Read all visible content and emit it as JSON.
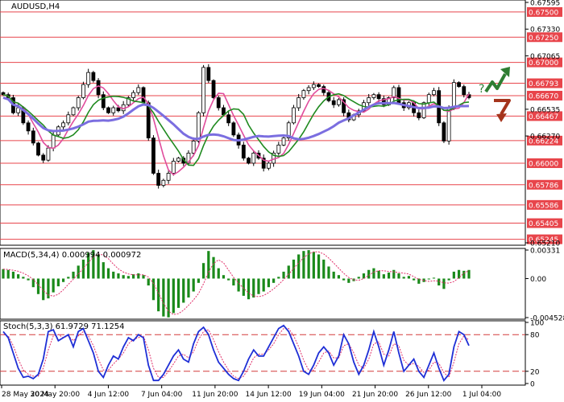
{
  "chart_data": {
    "type": "candlestick",
    "symbol": "AUDUSD,H4",
    "price_axis": {
      "ylim": [
        0.6521,
        0.67595
      ],
      "tick_labels": [
        "0.67595",
        "0.67330",
        "0.67065",
        "0.66535",
        "0.66270",
        "0.65210"
      ]
    },
    "levels": [
      {
        "value": "0.67500",
        "color": "#e8454b"
      },
      {
        "value": "0.67250",
        "color": "#e8454b"
      },
      {
        "value": "0.67000",
        "color": "#e8454b"
      },
      {
        "value": "0.66793",
        "color": "#e8454b"
      },
      {
        "value": "0.66670",
        "color": "#e8454b"
      },
      {
        "value": "0.66467",
        "color": "#e8454b"
      },
      {
        "value": "0.66224",
        "color": "#e8454b"
      },
      {
        "value": "0.66000",
        "color": "#e8454b"
      },
      {
        "value": "0.65786",
        "color": "#e8454b"
      },
      {
        "value": "0.65586",
        "color": "#e8454b"
      },
      {
        "value": "0.65405",
        "color": "#e8454b"
      },
      {
        "value": "0.65245",
        "color": "#e8454b"
      }
    ],
    "close_prices": [
      0.6668,
      0.6665,
      0.665,
      0.6655,
      0.664,
      0.6632,
      0.662,
      0.6608,
      0.6603,
      0.6615,
      0.6628,
      0.6636,
      0.664,
      0.6648,
      0.6655,
      0.6665,
      0.6678,
      0.669,
      0.6682,
      0.6668,
      0.6655,
      0.665,
      0.6655,
      0.6652,
      0.6658,
      0.6665,
      0.667,
      0.6675,
      0.666,
      0.6625,
      0.659,
      0.6578,
      0.6583,
      0.659,
      0.6602,
      0.6605,
      0.66,
      0.661,
      0.6622,
      0.665,
      0.6695,
      0.6682,
      0.6665,
      0.6655,
      0.6648,
      0.664,
      0.6628,
      0.6618,
      0.6605,
      0.66,
      0.661,
      0.6605,
      0.6595,
      0.66,
      0.661,
      0.6618,
      0.6625,
      0.664,
      0.6655,
      0.6665,
      0.6672,
      0.6675,
      0.6678,
      0.6676,
      0.667,
      0.6662,
      0.6658,
      0.6663,
      0.665,
      0.6643,
      0.6648,
      0.6652,
      0.666,
      0.6665,
      0.6668,
      0.6664,
      0.6658,
      0.6665,
      0.6675,
      0.666,
      0.6655,
      0.666,
      0.665,
      0.6645,
      0.666,
      0.6668,
      0.6672,
      0.664,
      0.6622,
      0.6655,
      0.668,
      0.6676,
      0.6668,
      0.6665
    ],
    "moving_averages": [
      {
        "color": "#e04c9c",
        "period_hint": "fast"
      },
      {
        "color": "#1f8a1f",
        "period_hint": "medium"
      },
      {
        "color": "#7b6ee0",
        "period_hint": "slow"
      }
    ],
    "arrows": [
      {
        "direction": "up",
        "color": "#2e7d32"
      },
      {
        "direction": "down",
        "color": "#a5341c"
      }
    ],
    "question_mark": "?",
    "macd": {
      "label": "MACD(5,34,4) 0.000994 0.000972",
      "tick_labels": [
        "0.00331",
        "0.00",
        "-0.004528"
      ],
      "ylim": [
        -0.004528,
        0.00331
      ],
      "values": [
        0.0011,
        0.001,
        0.0008,
        0.0005,
        0.0002,
        -0.0002,
        -0.001,
        -0.0018,
        -0.0025,
        -0.0023,
        -0.0016,
        -0.0009,
        -0.0004,
        0.0002,
        0.0008,
        0.0015,
        0.0022,
        0.003,
        0.0033,
        0.0028,
        0.0019,
        0.0012,
        0.0008,
        0.0006,
        0.0004,
        0.0003,
        0.0005,
        0.0006,
        0.0004,
        -0.0008,
        -0.0025,
        -0.0038,
        -0.0044,
        -0.0045,
        -0.004,
        -0.0034,
        -0.0028,
        -0.0022,
        -0.0015,
        -0.0005,
        0.0018,
        0.0032,
        0.0025,
        0.0012,
        0.0004,
        -0.0002,
        -0.0008,
        -0.0015,
        -0.002,
        -0.0024,
        -0.0022,
        -0.0018,
        -0.0015,
        -0.001,
        -0.0005,
        0.0002,
        0.0008,
        0.0015,
        0.0022,
        0.0028,
        0.0032,
        0.0033,
        0.0031,
        0.0028,
        0.0022,
        0.0014,
        0.0008,
        0.0004,
        -0.0002,
        -0.0005,
        -0.0003,
        0.0002,
        0.0006,
        0.001,
        0.0012,
        0.0009,
        0.0005,
        0.0007,
        0.001,
        0.0006,
        0.0002,
        0.0003,
        -0.0002,
        -0.0006,
        -0.0004,
        -0.0001,
        0.0001,
        -0.0008,
        -0.0012,
        -0.0002,
        0.0008,
        0.001,
        0.0009,
        0.001
      ]
    },
    "stochastic": {
      "label": "Stoch(5,3,3) 61.9729 71.1254",
      "tick_labels": [
        "100",
        "80",
        "20",
        "0"
      ],
      "levels": [
        80,
        20
      ],
      "ylim": [
        0,
        100
      ],
      "k_values": [
        85,
        75,
        50,
        25,
        10,
        12,
        8,
        15,
        40,
        85,
        88,
        70,
        75,
        80,
        60,
        85,
        90,
        70,
        50,
        20,
        10,
        30,
        45,
        40,
        60,
        75,
        70,
        80,
        75,
        30,
        5,
        5,
        15,
        30,
        45,
        55,
        40,
        35,
        65,
        85,
        92,
        80,
        55,
        35,
        25,
        15,
        8,
        5,
        20,
        40,
        55,
        45,
        45,
        60,
        75,
        90,
        95,
        85,
        65,
        45,
        20,
        15,
        30,
        50,
        60,
        50,
        30,
        45,
        80,
        65,
        35,
        15,
        30,
        55,
        85,
        60,
        30,
        55,
        85,
        50,
        20,
        30,
        40,
        20,
        10,
        30,
        50,
        25,
        5,
        15,
        60,
        85,
        80,
        62
      ],
      "d_values": [
        80,
        78,
        62,
        40,
        22,
        15,
        12,
        12,
        25,
        55,
        78,
        80,
        75,
        78,
        70,
        78,
        85,
        78,
        62,
        40,
        22,
        22,
        32,
        40,
        50,
        65,
        72,
        75,
        78,
        55,
        25,
        10,
        10,
        20,
        32,
        45,
        48,
        42,
        52,
        72,
        85,
        88,
        72,
        52,
        35,
        22,
        12,
        8,
        12,
        25,
        42,
        48,
        48,
        55,
        65,
        80,
        90,
        90,
        78,
        60,
        38,
        22,
        22,
        35,
        50,
        53,
        42,
        42,
        62,
        65,
        50,
        30,
        25,
        40,
        65,
        68,
        48,
        45,
        65,
        62,
        38,
        30,
        33,
        28,
        18,
        22,
        35,
        33,
        18,
        10,
        35,
        65,
        78,
        71
      ]
    },
    "x_tick_labels": [
      "28 May 2024",
      "30 May 20:00",
      "4 Jun 12:00",
      "7 Jun 04:00",
      "11 Jun 20:00",
      "14 Jun 12:00",
      "19 Jun 04:00",
      "21 Jun 20:00",
      "26 Jun 12:00",
      "1 Jul 04:00"
    ]
  }
}
